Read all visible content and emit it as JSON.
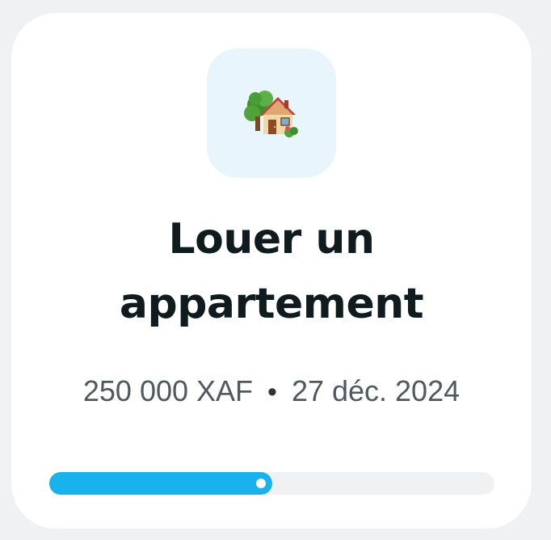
{
  "goal": {
    "icon": "house-with-garden-icon",
    "title_line1": "Louer un",
    "title_line2": "appartement",
    "amount": "250 000 XAF",
    "separator": "•",
    "date": "27 déc. 2024",
    "progress_fraction": 0.5
  },
  "colors": {
    "progress_fill": "#1ab1ef",
    "progress_track": "#f0f1f3",
    "icon_tile_bg": "#e9f5fd",
    "title": "#0f1b1f",
    "meta": "#4f5a5e"
  }
}
